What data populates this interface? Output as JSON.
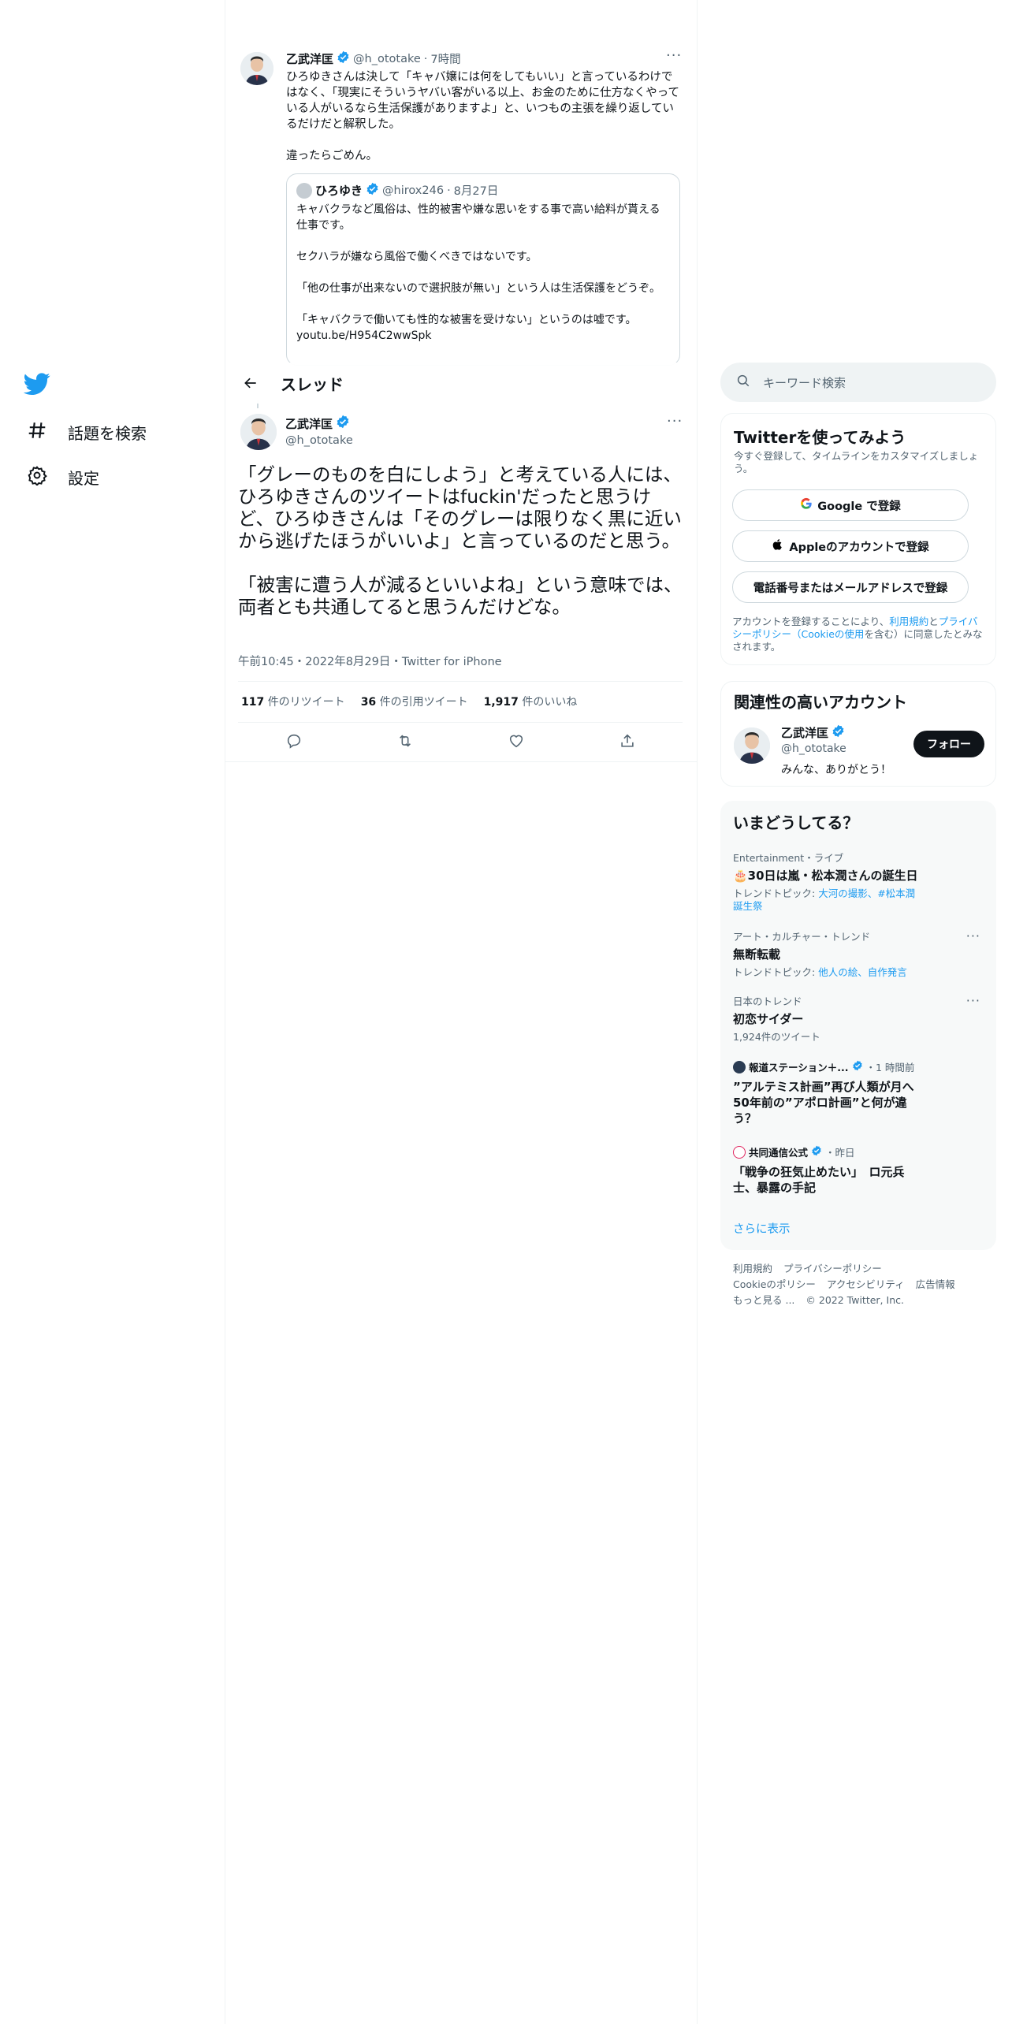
{
  "nav": {
    "items": [
      {
        "label": "話題を検索",
        "icon": "hashtag-icon"
      },
      {
        "label": "設定",
        "icon": "gear-icon"
      }
    ]
  },
  "header": {
    "title": "スレッド"
  },
  "prev_tweet": {
    "name": "乙武洋匡",
    "handle": "@h_ototake",
    "time": "7時間",
    "text": "ひろゆきさんは決して「キャバ嬢には何をしてもいい」と言っているわけではなく、「現実にそういうヤバい客がいる以上、お金のために仕方なくやっている人がいるなら生活保護がありますよ」と、いつもの主張を繰り返しているだけだと解釈した。\n\n違ったらごめん。",
    "quote": {
      "name": "ひろゆき",
      "handle": "@hirox246",
      "time": "8月27日",
      "text": "キャバクラなど風俗は、性的被害や嫌な思いをする事で高い給料が貰える仕事です。\n\nセクハラが嫌なら風俗で働くべきではないです。\n\n「他の仕事が出来ないので選択肢が無い」という人は生活保護をどうぞ。\n\n「キャバクラで働いても性的な被害を受けない」というのは嘘です。",
      "link": "youtu.be/H954C2wwSpk"
    }
  },
  "main_tweet": {
    "name": "乙武洋匡",
    "handle": "@h_ototake",
    "text": "「グレーのものを白にしよう」と考えている人には、ひろゆきさんのツイートはfuckin'だったと思うけど、ひろゆきさんは「そのグレーは限りなく黒に近いから逃げたほうがいいよ」と言っているのだと思う。\n\n「被害に遭う人が減るといいよね」という意味では、両者とも共通してると思うんだけどな。",
    "meta": "午前10:45・2022年8月29日・Twitter for iPhone",
    "stats": {
      "retweets": "117",
      "retweets_label": "件のリツイート",
      "quotes": "36",
      "quotes_label": "件の引用ツイート",
      "likes": "1,917",
      "likes_label": "件のいいね"
    }
  },
  "search": {
    "placeholder": "キーワード検索"
  },
  "signup": {
    "title": "Twitterを使ってみよう",
    "subtitle": "今すぐ登録して、タイムラインをカスタマイズしましょう。",
    "google": "Google で登録",
    "apple": "Appleのアカウントで登録",
    "phone": "電話番号またはメールアドレスで登録",
    "terms_1": "アカウントを登録することにより、",
    "terms_link1": "利用規約",
    "terms_2": "と",
    "terms_link2": "プライバシーポリシー（Cookieの使用",
    "terms_3": "を含む）に同意したとみなされます。"
  },
  "related": {
    "title": "関連性の高いアカウント",
    "name": "乙武洋匡",
    "handle": "@h_ototake",
    "bio": "みんな、ありがとう！",
    "follow": "フォロー"
  },
  "trends": {
    "title": "いまどうしてる？",
    "items": [
      {
        "category": "Entertainment・ライブ",
        "title": "🎂30日は嵐・松本潤さんの誕生日",
        "sub_prefix": "トレンドトピック: ",
        "sub_links": "大河の撮影、#松本潤誕生祭"
      },
      {
        "category": "アート・カルチャー・トレンド",
        "title": "無断転載",
        "sub_prefix": "トレンドトピック: ",
        "sub_links": "他人の絵、自作発言"
      },
      {
        "category": "日本のトレンド",
        "title": "初恋サイダー",
        "sub_prefix": "1,924件のツイート",
        "sub_links": ""
      }
    ],
    "news": [
      {
        "source": "報道ステーション＋...",
        "time": "・1 時間前",
        "title": "”アルテミス計画”再び人類が月へ　50年前の”アポロ計画”と何が違う？"
      },
      {
        "source": "共同通信公式",
        "time": "・昨日",
        "title": "「戦争の狂気止めたい」　ロ元兵士、暴露の手記"
      }
    ],
    "more": "さらに表示"
  },
  "footer": {
    "line1": [
      "利用規約",
      "プライバシーポリシー"
    ],
    "line2": [
      "Cookieのポリシー",
      "アクセシビリティ",
      "広告情報"
    ],
    "line3": [
      "もっと見る ...",
      "© 2022 Twitter, Inc."
    ]
  },
  "colors": {
    "accent": "#1d9bf0",
    "text": "#0f1419",
    "muted": "#536471",
    "border": "#eff3f4"
  }
}
